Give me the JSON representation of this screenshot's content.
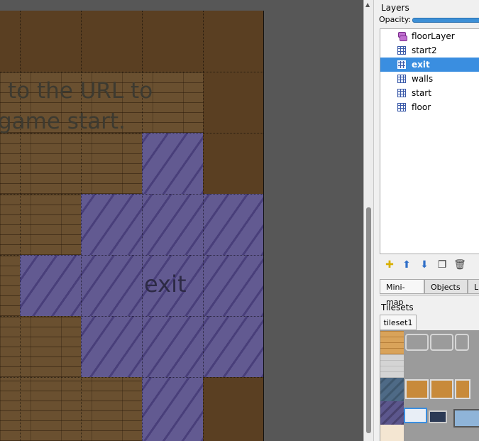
{
  "map": {
    "overlay_text_line1": "to the URL to",
    "overlay_text_line2": "game start.",
    "region_label": "exit"
  },
  "layers_panel": {
    "title": "Layers",
    "opacity_label": "Opacity:",
    "items": [
      {
        "label": "floorLayer",
        "icon": "object-layer-icon",
        "selected": false
      },
      {
        "label": "start2",
        "icon": "tile-layer-icon",
        "selected": false
      },
      {
        "label": "exit",
        "icon": "tile-layer-icon",
        "selected": true
      },
      {
        "label": "walls",
        "icon": "tile-layer-icon",
        "selected": false
      },
      {
        "label": "start",
        "icon": "tile-layer-icon",
        "selected": false
      },
      {
        "label": "floor",
        "icon": "tile-layer-icon",
        "selected": false
      }
    ],
    "toolbar_icons": [
      "new-layer-icon",
      "raise-layer-icon",
      "lower-layer-icon",
      "duplicate-layer-icon",
      "delete-layer-icon"
    ]
  },
  "dock_tabs": {
    "minimap": "Mini-map",
    "objects": "Objects",
    "cut": "L"
  },
  "tilesets_panel": {
    "title": "Tilesets",
    "tab": "tileset1"
  },
  "colors": {
    "selection": "#3a8ee0",
    "region_fill": "#625a91",
    "floor_wood": "#6a5030"
  }
}
